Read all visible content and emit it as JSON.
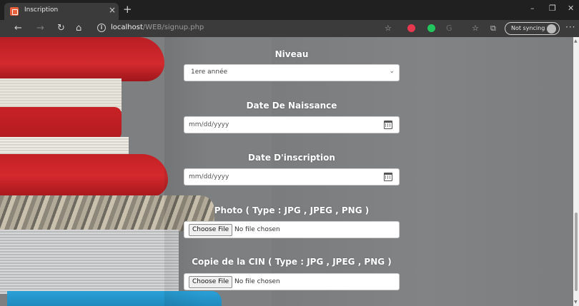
{
  "browser": {
    "tab_title": "Inscription",
    "tab_close": "×",
    "new_tab": "+",
    "url_host": "localhost",
    "url_path": "/WEB/signup.php",
    "sync_label": "Not syncing",
    "window": {
      "minimize": "–",
      "restore": "❐",
      "close": "✕"
    },
    "nav": {
      "back": "←",
      "forward": "→",
      "refresh": "↻",
      "home": "⌂"
    },
    "toolbar": {
      "favorite": "☆",
      "collections": "☆",
      "extensions": "⧉",
      "menu": "···"
    },
    "extension_colors": {
      "red": "#e8384f",
      "green": "#22c55e",
      "grey": "#6b6b6b"
    }
  },
  "form": {
    "niveau": {
      "label": "Niveau",
      "value": "1ere année"
    },
    "naissance": {
      "label": "Date De Naissance",
      "placeholder": "mm/dd/yyyy"
    },
    "inscription": {
      "label": "Date D'inscription",
      "placeholder": "mm/dd/yyyy"
    },
    "photo": {
      "label": "Photo ( Type : JPG , JPEG , PNG )",
      "button": "Choose File",
      "status": "No file chosen"
    },
    "cin": {
      "label": "Copie de la CIN ( Type : JPG , JPEG , PNG )",
      "button": "Choose File",
      "status": "No file chosen"
    }
  },
  "colors": {
    "label_text": "#ffffff",
    "page_bg": "#7d7f81"
  }
}
